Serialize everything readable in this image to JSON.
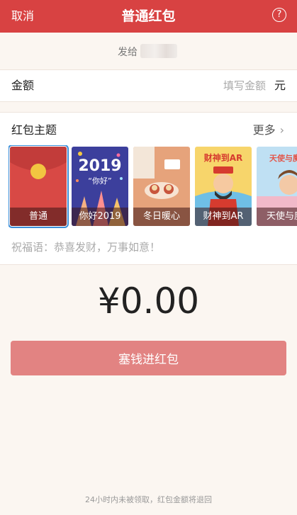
{
  "nav": {
    "cancel_label": "取消",
    "title": "普通红包",
    "help_icon": "?",
    "background": "#d84242"
  },
  "recipient": {
    "label": "发给"
  },
  "amount": {
    "label": "金额",
    "placeholder": "填写金额",
    "unit": "元"
  },
  "themes": {
    "title": "红包主题",
    "more_label": "更多",
    "items": [
      {
        "label": "普通",
        "selected": true
      },
      {
        "label": "你好2019",
        "art_text": "2019",
        "art_sub": "“你好”"
      },
      {
        "label": "冬日暖心"
      },
      {
        "label": "财神到AR",
        "art_text": "财神到AR"
      },
      {
        "label": "天使与魔",
        "art_text": "天使与魔"
      }
    ]
  },
  "blessing": {
    "placeholder": "祝福语：恭喜发财，万事如意！"
  },
  "total": {
    "display": "¥0.00"
  },
  "submit": {
    "label": "塞钱进红包",
    "color": "#e28382"
  },
  "footer": {
    "note": "24小时内未被领取，红包金额将退回"
  }
}
